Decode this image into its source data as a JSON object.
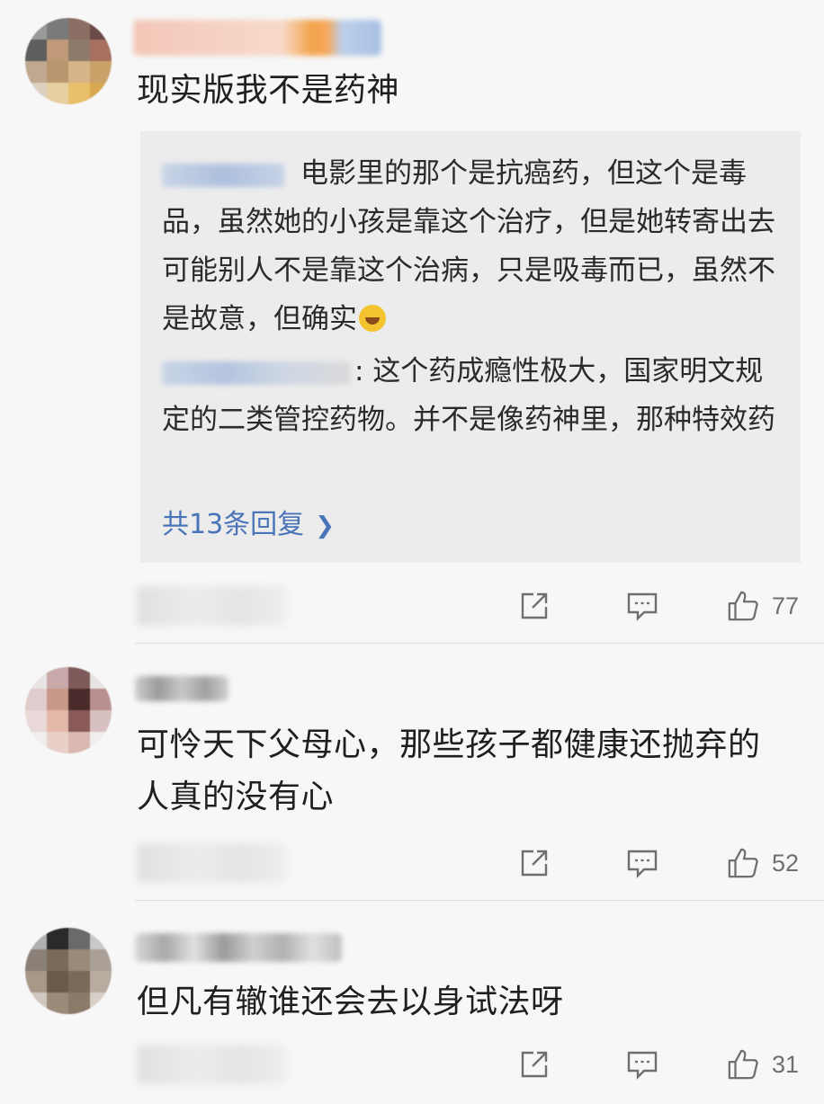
{
  "comments": [
    {
      "text": "现实版我不是药神",
      "replies": [
        {
          "text": "电影里的那个是抗癌药，但这个是毒品，虽然她的小孩是靠这个治疗，但是她转寄出去可能别人不是靠这个治病，只是吸毒而已，虽然不是故意，但确实"
        },
        {
          "text": ": 这个药成瘾性极大，国家明文规定的二类管控药物。并不是像药神里，那种特效药"
        }
      ],
      "more_replies": "共13条回复",
      "likes": "77"
    },
    {
      "text": "可怜天下父母心，那些孩子都健康还抛弃的人真的没有心",
      "likes": "52"
    },
    {
      "text": "但凡有辙谁还会去以身试法呀",
      "likes": "31"
    }
  ],
  "icons": {
    "share": "share-icon",
    "reply": "comment-icon",
    "like": "thumbs-up-icon",
    "chevron": "chevron-right-icon",
    "emoji": "laughing-crying-emoji"
  },
  "colors": {
    "link": "#4a74b8",
    "icon": "#6f6f6f",
    "reply_bg": "#ececec"
  }
}
